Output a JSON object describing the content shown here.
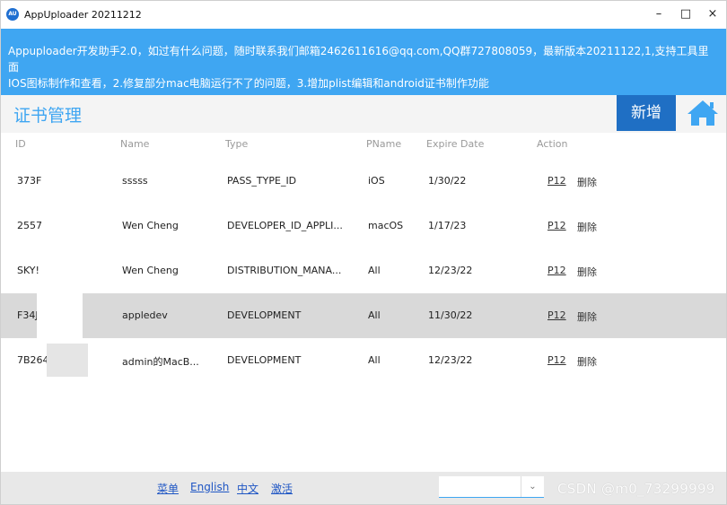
{
  "window": {
    "app_icon_text": "AU",
    "title": "AppUploader 20211212",
    "controls": {
      "minimize": "–",
      "maximize": "□",
      "close": "×"
    }
  },
  "notice": {
    "line1": "Appuploader开发助手2.0，如过有什么问题，随时联系我们邮箱2462611616@qq.com,QQ群727808059，最新版本20211122,1,支持工具里面",
    "line2": "IOS图标制作和查看，2.修复部分mac电脑运行不了的问题，3.增加plist编辑和android证书制作功能"
  },
  "header": {
    "title": "证书管理",
    "add_label": "新增",
    "home_icon": "home-icon"
  },
  "table": {
    "columns": [
      "ID",
      "Name",
      "Type",
      "PName",
      "Expire Date",
      "Action"
    ],
    "rows": [
      {
        "id": "373F",
        "name": "sssss",
        "type": "PASS_TYPE_ID",
        "pname": "iOS",
        "expire": "1/30/22",
        "p12": "P12",
        "del": "删除"
      },
      {
        "id": "2557",
        "name": "Wen Cheng",
        "type": "DEVELOPER_ID_APPLI...",
        "pname": "macOS",
        "expire": "1/17/23",
        "p12": "P12",
        "del": "删除"
      },
      {
        "id": "SKY!",
        "name": "Wen Cheng",
        "type": "DISTRIBUTION_MANA...",
        "pname": "All",
        "expire": "12/23/22",
        "p12": "P12",
        "del": "删除"
      },
      {
        "id": "F34J",
        "name": "appledev",
        "type": "DEVELOPMENT",
        "pname": "All",
        "expire": "11/30/22",
        "p12": "P12",
        "del": "删除"
      },
      {
        "id": "7B264",
        "name": "admin的MacB...",
        "type": "DEVELOPMENT",
        "pname": "All",
        "expire": "12/23/22",
        "p12": "P12",
        "del": "删除"
      }
    ]
  },
  "bottom": {
    "menu": "菜单",
    "english": "English",
    "chinese": "中文",
    "activate": "激活",
    "select_value": "",
    "dropdown_icon": "chevron-down-icon",
    "watermark": "CSDN @m0_73299999"
  }
}
